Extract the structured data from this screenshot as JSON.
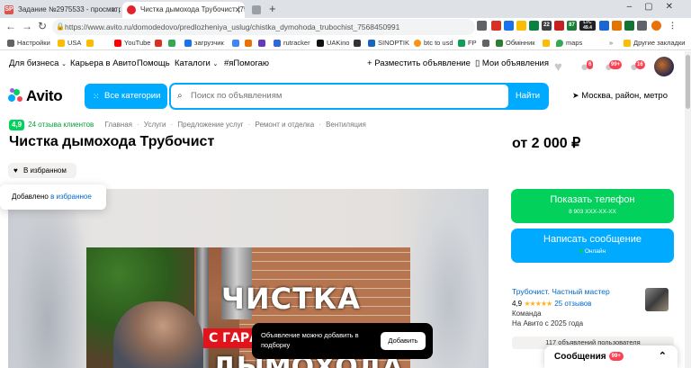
{
  "browser": {
    "tabs": [
      {
        "label": "Задание №2975533 - просмотр з",
        "favicon": "SP"
      },
      {
        "label": "Чистка дымохода Трубочист (756"
      },
      {
        "label": ""
      }
    ],
    "url": "https://www.avito.ru/domodedovo/predlozheniya_uslug/chistka_dymohoda_trubochist_7568450991",
    "bookmarks": [
      "Настройки",
      "USA",
      "YouTube",
      "загрузчик",
      "rutracker",
      "UAKino",
      "SINOPTIK",
      "btc to usd",
      "FP",
      "Обмінник",
      "maps",
      "Другие закладки"
    ],
    "ext_labels": [
      "LTC",
      "49.4",
      "22",
      "87"
    ]
  },
  "header": {
    "nav": [
      "Для бизнеса",
      "Карьера в Авито",
      "Помощь",
      "Каталоги",
      "#яПомогаю"
    ],
    "post_ad": "Разместить объявление",
    "my_ads": "Мои объявления",
    "badges": [
      "6",
      "99+",
      "16"
    ]
  },
  "search": {
    "logo": "Avito",
    "categories": "Все категории",
    "placeholder": "Поиск по объявлениям",
    "find": "Найти",
    "location": "Москва, район, метро"
  },
  "listing": {
    "rating": "4,9",
    "reviews": "24 отзыва клиентов",
    "breadcrumbs": [
      "Главная",
      "Услуги",
      "Предложение услуг",
      "Ремонт и отделка",
      "Вентиляция"
    ],
    "title": "Чистка дымохода Трубочист",
    "price": "от 2 000 ₽",
    "fav_button": "В избранном",
    "fav_tip_text": "Добавлено ",
    "fav_tip_link": "в избранное",
    "photo_text_1": "ЧИСТКА",
    "photo_text_banner": "С ГАРА",
    "photo_text_2": "ДЫМОХОДА"
  },
  "toast": {
    "text": "Объявление можно добавить в подборку",
    "button": "Добавить"
  },
  "sidebar": {
    "phone_button": "Показать телефон",
    "phone_number": "8 903 XXX-XX-XX",
    "message_button": "Написать сообщение",
    "online": "Онлайн",
    "seller_name": "Трубочист. Частный мастер",
    "seller_rating": "4,9",
    "stars": "★★★★★",
    "seller_reviews": "25 отзывов",
    "seller_type": "Команда",
    "seller_since": "На Авито с 2025 года",
    "ads_count": "117 объявлений пользователя"
  },
  "messages_panel": {
    "label": "Сообщения",
    "badge": "99+"
  },
  "colors": {
    "accent_blue": "#00aaff",
    "accent_green": "#02d15c",
    "link_blue": "#0069ce",
    "badge_red": "#ff4053"
  }
}
